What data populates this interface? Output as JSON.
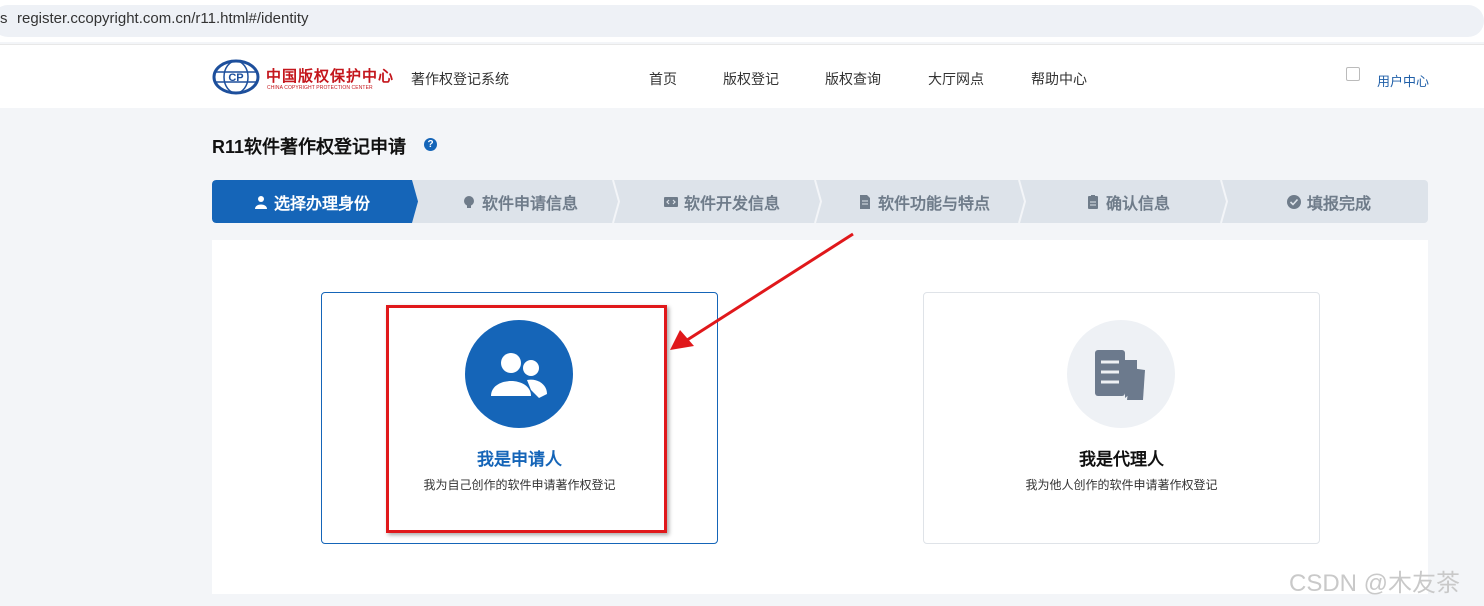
{
  "browser": {
    "url_fragment_left": "s",
    "url": "register.ccopyright.com.cn/r11.html#/identity"
  },
  "header": {
    "logo_cn": "中国版权保护中心",
    "logo_en": "CHINA COPYRIGHT PROTECTION CENTER",
    "system_name": "著作权登记系统",
    "nav": [
      "首页",
      "版权登记",
      "版权查询",
      "大厅网点",
      "帮助中心"
    ],
    "user_center": "用户中心"
  },
  "page": {
    "title": "R11软件著作权登记申请",
    "help_icon_text": "?"
  },
  "steps": [
    {
      "label": "选择办理身份",
      "icon": "user-icon",
      "active": true
    },
    {
      "label": "软件申请信息",
      "icon": "bulb-icon",
      "active": false
    },
    {
      "label": "软件开发信息",
      "icon": "code-icon",
      "active": false
    },
    {
      "label": "软件功能与特点",
      "icon": "document-icon",
      "active": false
    },
    {
      "label": "确认信息",
      "icon": "clipboard-icon",
      "active": false
    },
    {
      "label": "填报完成",
      "icon": "check-circle-icon",
      "active": false
    }
  ],
  "identity_options": [
    {
      "title": "我是申请人",
      "desc": "我为自己创作的软件申请著作权登记",
      "icon": "users-icon",
      "selected": true
    },
    {
      "title": "我是代理人",
      "desc": "我为他人创作的软件申请著作权登记",
      "icon": "papers-icon",
      "selected": false
    }
  ],
  "colors": {
    "primary": "#1565b8",
    "step_bg": "#dde3ea",
    "annotation": "#e0181b"
  },
  "watermark": "CSDN @木友茶"
}
